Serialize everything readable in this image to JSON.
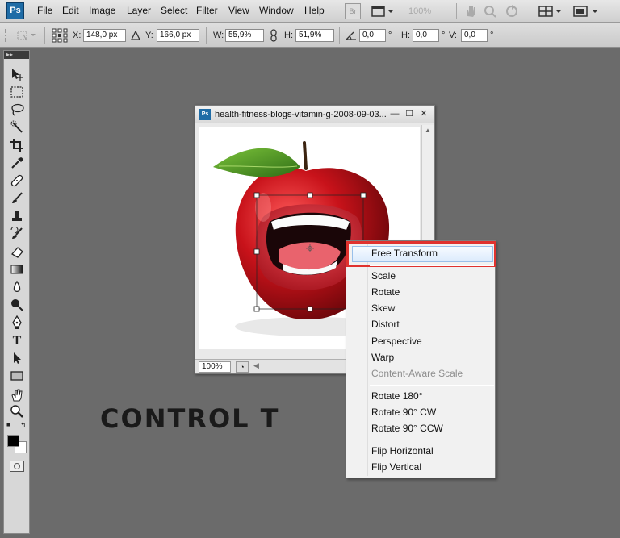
{
  "app": {
    "logo": "Ps",
    "menu": [
      "File",
      "Edit",
      "Image",
      "Layer",
      "Select",
      "Filter",
      "View",
      "Window",
      "Help"
    ],
    "bridge_button": "Br",
    "zoom_readout": "100%"
  },
  "options_bar": {
    "x_label": "X:",
    "x_value": "148,0 px",
    "y_label": "Y:",
    "y_value": "166,0 px",
    "w_label": "W:",
    "w_value": "55,9%",
    "h_label": "H:",
    "h_value": "51,9%",
    "angle_value": "0,0",
    "angle_unit": "°",
    "hskew_label": "H:",
    "hskew_value": "0,0",
    "vskew_label": "V:",
    "vskew_value": "0,0",
    "deg": "°"
  },
  "document": {
    "title": "health-fitness-blogs-vitamin-g-2008-09-03...",
    "zoom": "100%"
  },
  "context_menu": {
    "items": [
      {
        "label": "Free Transform",
        "enabled": true,
        "highlighted": true
      },
      {
        "label": "Scale",
        "enabled": true
      },
      {
        "label": "Rotate",
        "enabled": true
      },
      {
        "label": "Skew",
        "enabled": true
      },
      {
        "label": "Distort",
        "enabled": true
      },
      {
        "label": "Perspective",
        "enabled": true
      },
      {
        "label": "Warp",
        "enabled": true
      },
      {
        "label": "Content-Aware Scale",
        "enabled": false
      },
      {
        "label": "Rotate 180°",
        "enabled": true
      },
      {
        "label": "Rotate 90° CW",
        "enabled": true
      },
      {
        "label": "Rotate 90° CCW",
        "enabled": true
      },
      {
        "label": "Flip Horizontal",
        "enabled": true
      },
      {
        "label": "Flip Vertical",
        "enabled": true
      }
    ]
  },
  "caption": "CONTROL T",
  "colors": {
    "highlight_border": "#e0322e",
    "workspace": "#6b6b6b",
    "foreground": "#000000",
    "background": "#ffffff"
  },
  "icons": {
    "toolbox": [
      "move-icon",
      "marquee-icon",
      "lasso-icon",
      "quick-selection-icon",
      "crop-icon",
      "eyedropper-icon",
      "healing-brush-icon",
      "brush-icon",
      "clone-stamp-icon",
      "history-brush-icon",
      "eraser-icon",
      "gradient-icon",
      "blur-icon",
      "dodge-icon",
      "pen-icon",
      "type-icon",
      "path-selection-icon",
      "rectangle-icon",
      "hand-icon",
      "zoom-icon"
    ]
  }
}
